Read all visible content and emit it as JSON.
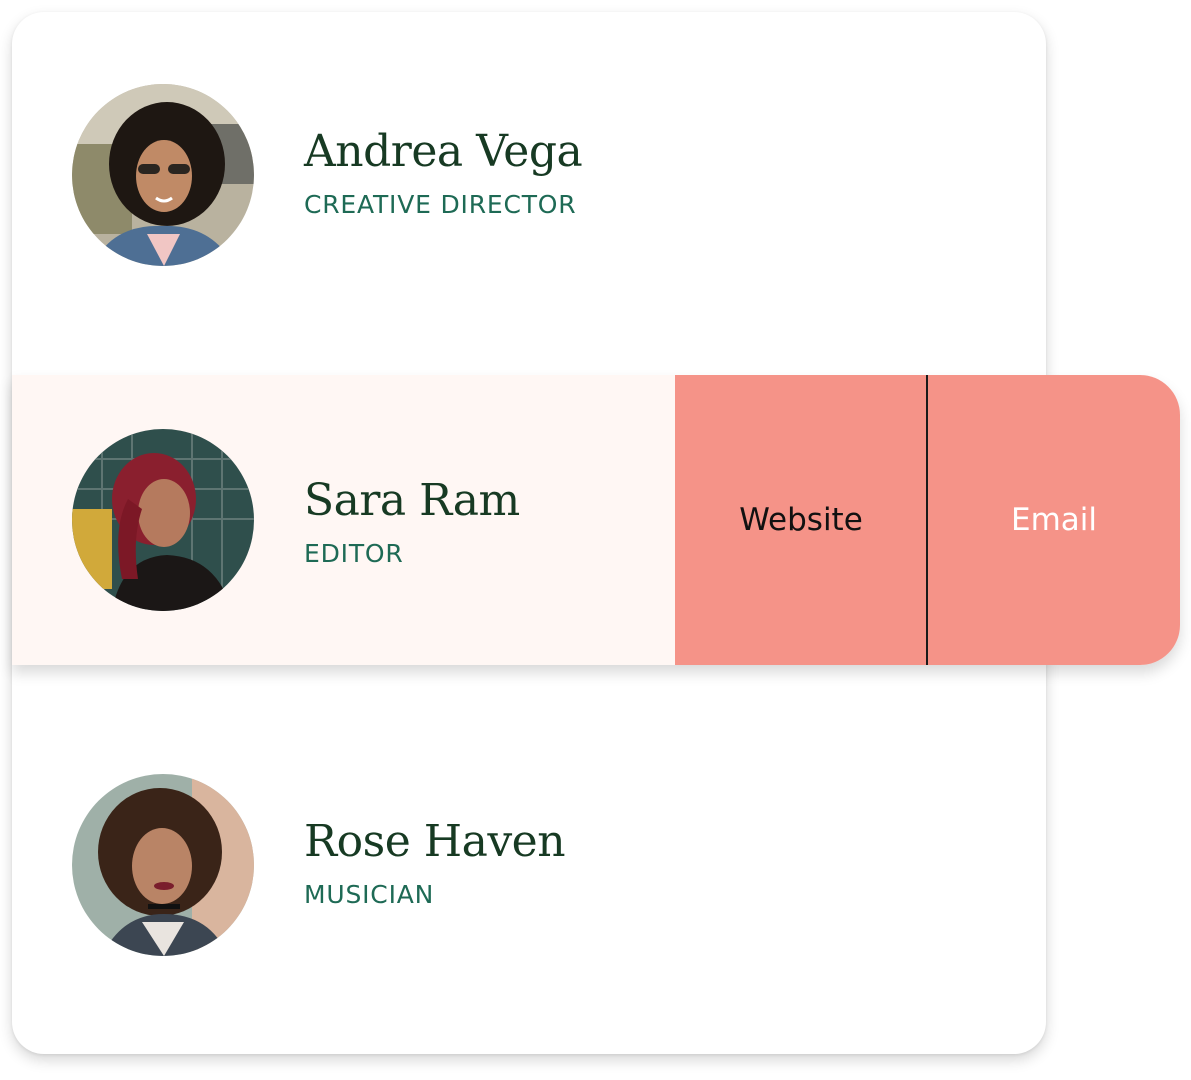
{
  "people": [
    {
      "name": "Andrea Vega",
      "role": "CREATIVE DIRECTOR"
    },
    {
      "name": "Sara Ram",
      "role": "EDITOR"
    },
    {
      "name": "Rose Haven",
      "role": "MUSICIAN"
    }
  ],
  "actions": {
    "website_label": "Website",
    "email_label": "Email"
  },
  "colors": {
    "name_text": "#173a23",
    "role_text": "#1e6a55",
    "action_bg": "#f59388",
    "swiped_row_bg": "#fff7f4",
    "email_text": "#ffffff",
    "website_text": "#111111"
  }
}
